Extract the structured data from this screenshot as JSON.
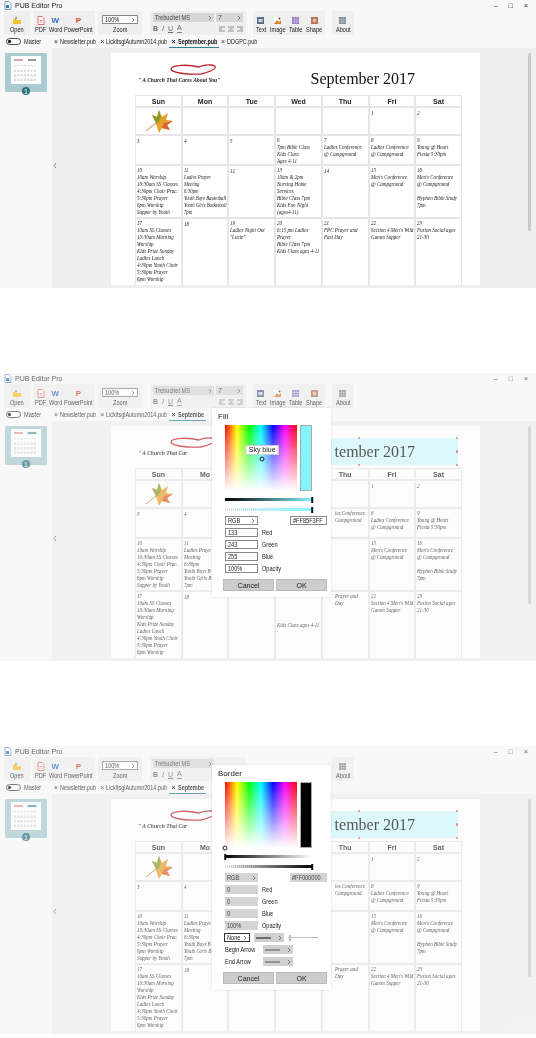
{
  "screens": [
    {
      "window": {
        "title": "PUB Editor Pro",
        "controls": [
          "–",
          "□",
          "×"
        ]
      },
      "ribbon": {
        "open": {
          "label": "Open"
        },
        "export": [
          {
            "label": "PDF",
            "kind": "pdf"
          },
          {
            "label": "Word",
            "kind": "letter",
            "glyph": "W"
          },
          {
            "label": "PowerPoint",
            "kind": "letter",
            "glyph": "P"
          }
        ],
        "zoom": {
          "value": "100%",
          "label": "Zoom"
        },
        "font": {
          "family": "Trebuchet MS",
          "size": "7",
          "styles": [
            "B",
            "I",
            "U",
            "A"
          ],
          "align_buttons": true,
          "disabled": true
        },
        "insert": [
          {
            "label": "Text",
            "kind": "text"
          },
          {
            "label": "Image",
            "kind": "image"
          },
          {
            "label": "Table",
            "kind": "table"
          },
          {
            "label": "Shape",
            "kind": "shape"
          }
        ],
        "about": {
          "label": "About"
        }
      },
      "master": {
        "label": "Master",
        "on": false
      },
      "tabs": [
        {
          "label": "Newsletter.pub",
          "close": "×",
          "selected": false
        },
        {
          "label": "LickitsglAutumn2014.pub",
          "close": "×",
          "selected": false
        },
        {
          "label": "September.pub",
          "close": "×",
          "selected": true
        },
        {
          "label": "DDGPC.pub",
          "close": "×",
          "selected": false
        }
      ],
      "thumbnails": [
        {
          "number": "1",
          "selected": true
        }
      ],
      "page": {
        "logo": "\" A Church That Cares About You\"",
        "title": "September 2017",
        "title_selected": false,
        "columns": [
          {
            "header": "Sun",
            "cells": [
              {
                "kind": "leaf"
              },
              {
                "kind": "text",
                "blocks": [
                  [
                    "3"
                  ]
                ]
              },
              {
                "kind": "text",
                "blocks": [
                  [
                    "10",
                    "10am Worship",
                    "10:30am SS Classes",
                    "4:30pm Choir Prac.",
                    "5:30pm Prayer",
                    "6pm Worship",
                    "Supper by Youth"
                  ]
                ]
              },
              {
                "kind": "text",
                "blocks": [
                  [
                    "17",
                    "10am SS Classes",
                    "10:30am Morning",
                    "Worship",
                    "Kids Prize Sunday",
                    "Ladies Lunch",
                    "4:30pm Youth Choir",
                    "5:30pm Prayer",
                    "6pm Worship"
                  ]
                ]
              }
            ]
          },
          {
            "header": "Mon",
            "cells": [
              {
                "kind": "empty"
              },
              {
                "kind": "text",
                "blocks": [
                  [
                    "4"
                  ]
                ]
              },
              {
                "kind": "text",
                "blocks": [
                  [
                    "11",
                    "Ladies Prayer",
                    "Meeting",
                    "6:30pm",
                    "Youth Boys Basketball",
                    "Youth Girls Basketball",
                    "7pm"
                  ]
                ]
              },
              {
                "kind": "text",
                "blocks": [
                  [
                    "18"
                  ]
                ]
              }
            ]
          },
          {
            "header": "Tue",
            "cells": [
              {
                "kind": "empty"
              },
              {
                "kind": "text",
                "blocks": [
                  [
                    "5"
                  ]
                ]
              },
              {
                "kind": "text",
                "blocks": [
                  [
                    "12"
                  ]
                ]
              },
              {
                "kind": "text",
                "blocks": [
                  [
                    "19",
                    "Ladies Night Out",
                    "\"Lucie\""
                  ]
                ]
              }
            ]
          },
          {
            "header": "Wed",
            "cells": [
              {
                "kind": "empty"
              },
              {
                "kind": "text",
                "blocks": [
                  [
                    "6",
                    "7pm Bible Class",
                    "Kids Class",
                    "Ages 4-11"
                  ]
                ]
              },
              {
                "kind": "text",
                "blocks": [
                  [
                    "13",
                    "10am & 2pm",
                    "Nursing Home",
                    "Services",
                    "Bible Class 7pm",
                    "Kids Fun Night",
                    "(ages4-11)"
                  ]
                ]
              },
              {
                "kind": "text",
                "blocks": [
                  [
                    "20",
                    "6:15 pm Ladies",
                    "Prayer",
                    "Bible Class 7pm",
                    "Kids Class ages 4-11"
                  ]
                ]
              }
            ]
          },
          {
            "header": "Thu",
            "cells": [
              {
                "kind": "empty"
              },
              {
                "kind": "text",
                "blocks": [
                  [
                    "7",
                    "Ladies Conference",
                    "@ Campground"
                  ]
                ]
              },
              {
                "kind": "text",
                "blocks": [
                  [
                    "14"
                  ]
                ]
              },
              {
                "kind": "text",
                "blocks": [
                  [
                    "21",
                    "FPC Prayer and",
                    "Fast Day"
                  ]
                ]
              }
            ]
          },
          {
            "header": "Fri",
            "cells": [
              {
                "kind": "text",
                "blocks": [
                  [
                    "1"
                  ]
                ]
              },
              {
                "kind": "text",
                "blocks": [
                  [
                    "8",
                    "Ladies Conference",
                    "@ Campground"
                  ]
                ]
              },
              {
                "kind": "text",
                "blocks": [
                  [
                    "15",
                    "Men's Conference",
                    "@ Campground"
                  ]
                ]
              },
              {
                "kind": "text",
                "blocks": [
                  [
                    "22",
                    "Section 4 Men's Wild",
                    "Games Supper"
                  ]
                ]
              }
            ]
          },
          {
            "header": "Sat",
            "cells": [
              {
                "kind": "text",
                "blocks": [
                  [
                    "2"
                  ]
                ]
              },
              {
                "kind": "text",
                "blocks": [
                  [
                    "9",
                    "Young @ Heart",
                    "Fiesta 5:30pm"
                  ]
                ]
              },
              {
                "kind": "text",
                "blocks": [
                  [
                    "16",
                    "Men's Conference",
                    "@ Campground"
                  ],
                  [
                    "Hyphen Bible Study",
                    "7pm"
                  ]
                ]
              },
              {
                "kind": "text",
                "blocks": [
                  [
                    "23",
                    "Fusion Social ages",
                    "21-30"
                  ]
                ]
              }
            ]
          }
        ]
      }
    },
    {
      "window": {
        "title": "PUB Editor Pro",
        "controls": [
          "–",
          "□",
          "×"
        ]
      },
      "ribbon": {
        "open": {
          "label": "Open"
        },
        "export": [
          {
            "label": "PDF",
            "kind": "pdf"
          },
          {
            "label": "Word",
            "kind": "letter",
            "glyph": "W"
          },
          {
            "label": "PowerPoint",
            "kind": "letter",
            "glyph": "P"
          }
        ],
        "zoom": {
          "value": "100%",
          "label": "Zoom"
        },
        "font": {
          "family": "Trebuchet MS",
          "size": "7",
          "styles": [
            "B",
            "I",
            "U",
            "A"
          ],
          "align_buttons": true,
          "disabled": true
        },
        "insert": [
          {
            "label": "Text",
            "kind": "text"
          },
          {
            "label": "Image",
            "kind": "image"
          },
          {
            "label": "Table",
            "kind": "table"
          },
          {
            "label": "Shape",
            "kind": "shape"
          }
        ],
        "about": {
          "label": "About"
        }
      },
      "master": {
        "label": "Master",
        "on": false
      },
      "tabs": [
        {
          "label": "Newsletter.pub",
          "close": "×",
          "selected": false
        },
        {
          "label": "LickitsglAutumn2014.pub",
          "close": "×",
          "selected": false
        },
        {
          "label": "Septembe",
          "close": "×",
          "selected": true
        }
      ],
      "thumbnails": [
        {
          "number": "1",
          "selected": true
        }
      ],
      "page": {
        "logo": "\" A Church That Car",
        "title": "tember 2017",
        "title_selected": true,
        "columns": [
          {
            "header": "Sun",
            "cells": [
              {
                "kind": "leaf"
              },
              {
                "kind": "text",
                "blocks": [
                  [
                    "3"
                  ]
                ]
              },
              {
                "kind": "text",
                "blocks": [
                  [
                    "10",
                    "10am Worship",
                    "10:30am SS Classes",
                    "4:30pm Choir Prac.",
                    "5:30pm Prayer",
                    "6pm Worship",
                    "Supper by Youth"
                  ]
                ]
              },
              {
                "kind": "text",
                "blocks": [
                  [
                    "17",
                    "10am SS Classes",
                    "10:30am Morning",
                    "Worship",
                    "Kids Prize Sunday",
                    "Ladies Lunch",
                    "4:30pm Youth Choir",
                    "5:30pm Prayer",
                    "6pm Worship"
                  ]
                ]
              }
            ]
          },
          {
            "header": "Mo",
            "cells": [
              {
                "kind": "empty"
              },
              {
                "kind": "text",
                "blocks": [
                  [
                    "4"
                  ]
                ]
              },
              {
                "kind": "text",
                "blocks": [
                  [
                    "11",
                    "Ladies Praye",
                    "Meeting",
                    "6:30pm",
                    "Youth Boys B",
                    "Youth Girls B",
                    "7pm"
                  ]
                ]
              },
              {
                "kind": "text",
                "blocks": [
                  [
                    "18"
                  ]
                ]
              }
            ]
          },
          {
            "cells": [
              {
                "kind": "empty"
              },
              {
                "kind": "empty"
              },
              {
                "kind": "empty"
              },
              {
                "kind": "empty"
              }
            ]
          },
          {
            "cells": [
              {
                "kind": "empty"
              },
              {
                "kind": "empty"
              },
              {
                "kind": "empty"
              },
              {
                "kind": "below",
                "blocks": [
                  [
                    "Kids Class ages 4-11"
                  ]
                ]
              }
            ]
          },
          {
            "header": "Thu",
            "cells": [
              {
                "kind": "empty"
              },
              {
                "kind": "cut_left",
                "blocks": [
                  [
                    "ies Conference",
                    "Campground"
                  ]
                ]
              },
              {
                "kind": "empty"
              },
              {
                "kind": "cut_left",
                "blocks": [
                  [
                    "Prayer and",
                    "Day"
                  ]
                ]
              }
            ]
          },
          {
            "header": "Fri",
            "cells": [
              {
                "kind": "text",
                "blocks": [
                  [
                    "1"
                  ]
                ]
              },
              {
                "kind": "text",
                "blocks": [
                  [
                    "8",
                    "Ladies Conference",
                    "@ Campground"
                  ]
                ]
              },
              {
                "kind": "text",
                "blocks": [
                  [
                    "15",
                    "Men's Conference",
                    "@ Campground"
                  ]
                ]
              },
              {
                "kind": "text",
                "blocks": [
                  [
                    "22",
                    "Section 4 Men's Wild",
                    "Games Supper"
                  ]
                ]
              }
            ]
          },
          {
            "header": "Sat",
            "cells": [
              {
                "kind": "text",
                "blocks": [
                  [
                    "2"
                  ]
                ]
              },
              {
                "kind": "text",
                "blocks": [
                  [
                    "9",
                    "Young @ Heart",
                    "Fiesta 5:30pm"
                  ]
                ]
              },
              {
                "kind": "text",
                "blocks": [
                  [
                    "16",
                    "Men's Conference",
                    "@ Campground"
                  ],
                  [
                    "Hyphen Bible Study",
                    "7pm"
                  ]
                ]
              },
              {
                "kind": "text",
                "blocks": [
                  [
                    "23",
                    "Fusion Social ages",
                    "21-30"
                  ]
                ]
              }
            ]
          }
        ]
      },
      "dialog": {
        "kind": "fill",
        "title": "Fill",
        "tooltip": "Sky blue",
        "disabled": false,
        "brightness": {
          "level": 1
        },
        "opacity": {
          "level": 1
        },
        "mode": "RGB",
        "hex": "#FF85F3FF",
        "channels": [
          {
            "label": "Red",
            "value": "133"
          },
          {
            "label": "Green",
            "value": "243"
          },
          {
            "label": "Blue",
            "value": "255"
          },
          {
            "label": "Opacity",
            "value": "100%"
          }
        ],
        "buttons": [
          "Cancel",
          "OK"
        ]
      }
    },
    {
      "window": {
        "title": "PUB Editor Pro",
        "controls": [
          "–",
          "□",
          "×"
        ]
      },
      "ribbon": {
        "open": {
          "label": "Open"
        },
        "export": [
          {
            "label": "PDF",
            "kind": "pdf"
          },
          {
            "label": "Word",
            "kind": "letter",
            "glyph": "W"
          },
          {
            "label": "PowerPoint",
            "kind": "letter",
            "glyph": "P"
          }
        ],
        "zoom": {
          "value": "100%",
          "label": "Zoom"
        },
        "font": {
          "family": "Trebuchet MS",
          "styles": [
            "B",
            "I",
            "U",
            "A"
          ],
          "align_buttons": false,
          "disabled": true
        },
        "about": {
          "label": "About"
        }
      },
      "master": {
        "label": "Master",
        "on": false
      },
      "tabs": [
        {
          "label": "Newsletter.pub",
          "close": "×",
          "selected": false
        },
        {
          "label": "LickitsglAutumn2014.pub",
          "close": "×",
          "selected": false
        },
        {
          "label": "Septembe",
          "close": "×",
          "selected": true
        }
      ],
      "thumbnails": [
        {
          "number": "1",
          "selected": true
        }
      ],
      "page": {
        "logo": "\" A Church That Car",
        "title": "tember 2017",
        "title_selected": true,
        "columns": [
          {
            "header": "Sun",
            "cells": [
              {
                "kind": "leaf"
              },
              {
                "kind": "text",
                "blocks": [
                  [
                    "3"
                  ]
                ]
              },
              {
                "kind": "text",
                "blocks": [
                  [
                    "10",
                    "10am Worship",
                    "10:30am SS Classes",
                    "4:30pm Choir Prac.",
                    "5:30pm Prayer",
                    "6pm Worship",
                    "Supper by Youth"
                  ]
                ]
              },
              {
                "kind": "text",
                "blocks": [
                  [
                    "17",
                    "10am SS Classes",
                    "10:30am Morning",
                    "Worship",
                    "Kids Prize Sunday",
                    "Ladies Lunch",
                    "4:30pm Youth Choir",
                    "5:30pm Prayer",
                    "6pm Worship"
                  ]
                ]
              }
            ]
          },
          {
            "header": "Mo",
            "cells": [
              {
                "kind": "empty"
              },
              {
                "kind": "text",
                "blocks": [
                  [
                    "4"
                  ]
                ]
              },
              {
                "kind": "text",
                "blocks": [
                  [
                    "11",
                    "Ladies Praye",
                    "Meeting",
                    "6:30pm",
                    "Youth Boys B",
                    "Youth Girls B",
                    "7pm"
                  ]
                ]
              },
              {
                "kind": "text",
                "blocks": [
                  [
                    "18"
                  ]
                ]
              }
            ]
          },
          {
            "cells": [
              {
                "kind": "empty"
              },
              {
                "kind": "empty"
              },
              {
                "kind": "empty"
              },
              {
                "kind": "empty"
              }
            ]
          },
          {
            "cells": [
              {
                "kind": "empty"
              },
              {
                "kind": "empty"
              },
              {
                "kind": "empty"
              },
              {
                "kind": "empty"
              }
            ]
          },
          {
            "header": "Thu",
            "cells": [
              {
                "kind": "empty"
              },
              {
                "kind": "cut_left",
                "blocks": [
                  [
                    "ies Conference",
                    "Campground"
                  ]
                ]
              },
              {
                "kind": "empty"
              },
              {
                "kind": "cut_left",
                "blocks": [
                  [
                    "Prayer and",
                    "Day"
                  ]
                ]
              }
            ]
          },
          {
            "header": "Fri",
            "cells": [
              {
                "kind": "text",
                "blocks": [
                  [
                    "1"
                  ]
                ]
              },
              {
                "kind": "text",
                "blocks": [
                  [
                    "8",
                    "Ladies Conference",
                    "@ Campground"
                  ]
                ]
              },
              {
                "kind": "text",
                "blocks": [
                  [
                    "15",
                    "Men's Conference",
                    "@ Campground"
                  ]
                ]
              },
              {
                "kind": "text",
                "blocks": [
                  [
                    "22",
                    "Section 4 Men's Wild",
                    "Games Supper"
                  ]
                ]
              }
            ]
          },
          {
            "header": "Sat",
            "cells": [
              {
                "kind": "text",
                "blocks": [
                  [
                    "2"
                  ]
                ]
              },
              {
                "kind": "text",
                "blocks": [
                  [
                    "9",
                    "Young @ Heart",
                    "Fiesta 5:30pm"
                  ]
                ]
              },
              {
                "kind": "text",
                "blocks": [
                  [
                    "16",
                    "Men's Conference",
                    "@ Campground"
                  ],
                  [
                    "Hyphen Bible Study",
                    "7pm"
                  ]
                ]
              },
              {
                "kind": "text",
                "blocks": [
                  [
                    "23",
                    "Fusion Social ages",
                    "21-30"
                  ]
                ]
              }
            ]
          }
        ]
      },
      "dialog": {
        "kind": "border",
        "title": "Border",
        "disabled": true,
        "brightness": {
          "level": 0
        },
        "opacity": {
          "level": 1
        },
        "mode": "RGB",
        "hex": "#FF000000",
        "channels": [
          {
            "label": "Red",
            "value": "0"
          },
          {
            "label": "Green",
            "value": "0"
          },
          {
            "label": "Blue",
            "value": "0"
          },
          {
            "label": "Opacity",
            "value": "100%"
          }
        ],
        "line": {
          "style": "None",
          "width": {
            "level": 0.05
          },
          "arrows": [
            "Begin Arrow",
            "End Arrow"
          ]
        },
        "buttons": [
          "Cancel",
          "OK"
        ]
      }
    }
  ]
}
